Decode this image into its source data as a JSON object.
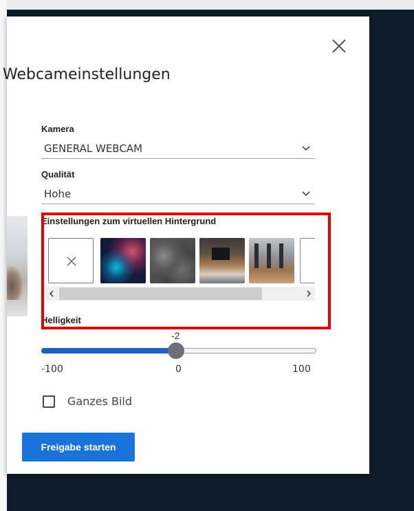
{
  "dialog": {
    "title": "Webcameinstellungen",
    "close_icon": "close-icon"
  },
  "camera": {
    "label": "Kamera",
    "selected": "GENERAL WEBCAM"
  },
  "quality": {
    "label": "Qualität",
    "selected": "Hohe"
  },
  "virtual_background": {
    "label": "Einstellungen zum virtuellen Hintergrund",
    "thumbnails": [
      {
        "kind": "none",
        "icon": "x-icon"
      },
      {
        "kind": "space-nebula"
      },
      {
        "kind": "stone-texture"
      },
      {
        "kind": "office-lounge"
      },
      {
        "kind": "office-windows"
      },
      {
        "kind": "partial"
      }
    ],
    "highlight_color": "#e60000"
  },
  "brightness": {
    "label": "Helligkeit",
    "value": "-2",
    "min": "-100",
    "center": "0",
    "max": "100",
    "numeric_value": -2,
    "range": [
      -100,
      100
    ]
  },
  "fullscreen_checkbox": {
    "label": "Ganzes Bild",
    "checked": false
  },
  "start_button": {
    "label": "Freigabe starten"
  },
  "colors": {
    "accent": "#1a73d9",
    "slider_fill": "#1f5fbf",
    "backdrop": "#0f1c2b"
  }
}
